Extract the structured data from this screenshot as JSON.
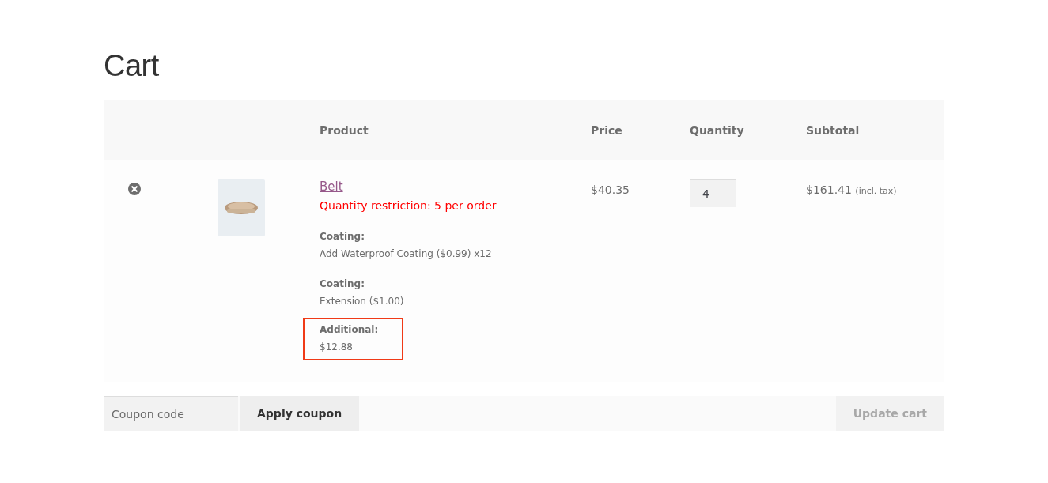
{
  "title": "Cart",
  "columns": [
    "Product",
    "Price",
    "Quantity",
    "Subtotal"
  ],
  "items": [
    {
      "name": "Belt",
      "notice": "Quantity restriction: 5 per order",
      "price": "$40.35",
      "quantity": "4",
      "subtotal": "$161.41",
      "subtotal_note": "(incl. tax)",
      "meta": [
        {
          "label": "Coating:",
          "value": "Add Waterproof Coating ($0.99) x12",
          "highlighted": false
        },
        {
          "label": "Coating:",
          "value": "Extension ($1.00)",
          "highlighted": false
        },
        {
          "label": "Additional:",
          "value": "$12.88",
          "highlighted": true
        }
      ]
    }
  ],
  "coupon": {
    "placeholder": "Coupon code",
    "button": "Apply coupon"
  },
  "update_button": {
    "label": "Update cart",
    "disabled": true
  }
}
